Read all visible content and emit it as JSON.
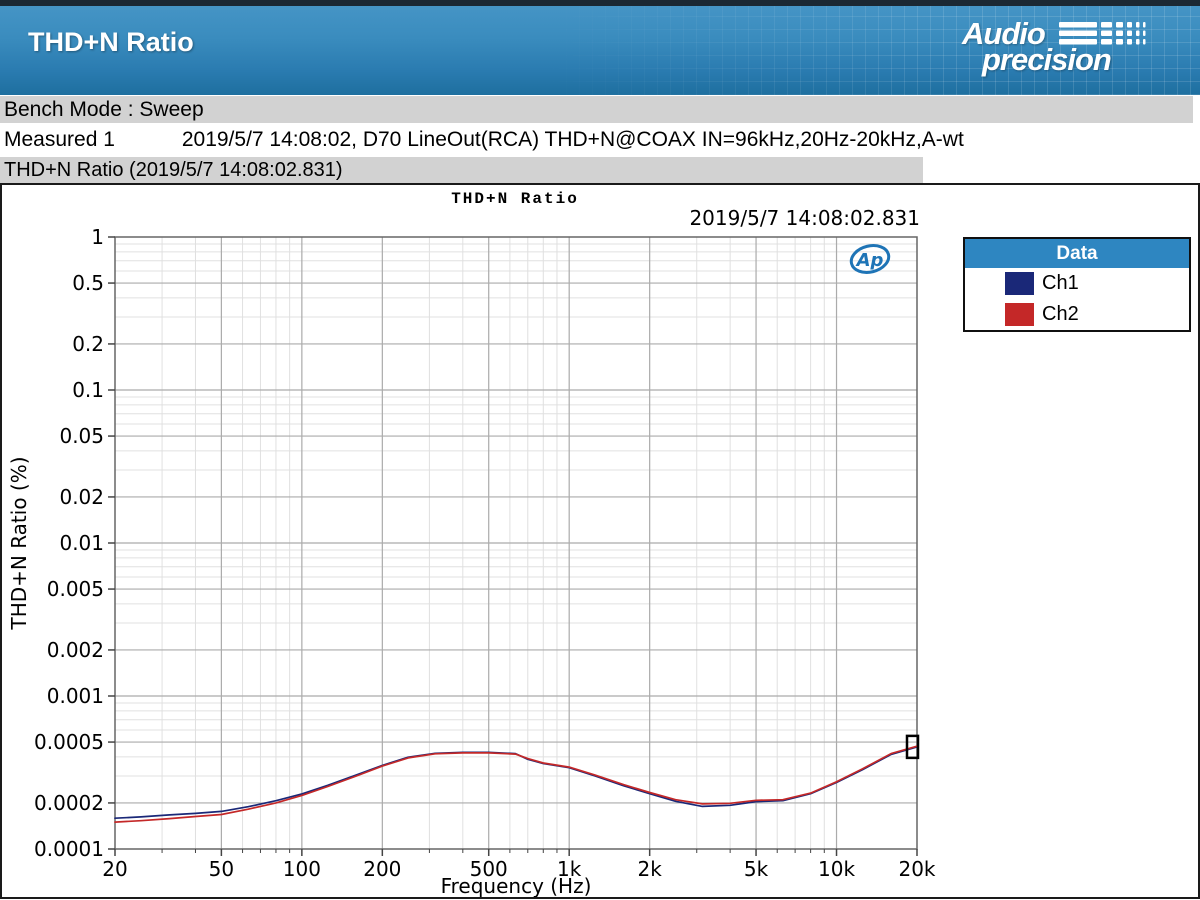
{
  "header": {
    "title": "THD+N Ratio",
    "logo_line1": "Audio",
    "logo_line2": "precision"
  },
  "bench_mode_label": "Bench Mode : Sweep",
  "measured": {
    "label": "Measured 1",
    "value": "2019/5/7 14:08:02, D70 LineOut(RCA) THD+N@COAX IN=96kHz,20Hz-20kHz,A-wt"
  },
  "section_title": "THD+N Ratio (2019/5/7 14:08:02.831)",
  "colors": {
    "header_blue_top": "#4796c7",
    "header_blue_bottom": "#1e6f9f",
    "bar_gray": "#d2d2d2",
    "legend_header_blue": "#2e86c1",
    "grid_major": "#ababab",
    "grid_minor": "#e0e0e0",
    "plot_border": "#666666",
    "tick_color": "#444444",
    "ap_logo_blue": "#1e74b6"
  },
  "chart_data": {
    "type": "line",
    "title": "THD+N Ratio",
    "timestamp": "2019/5/7 14:08:02.831",
    "xlabel": "Frequency (Hz)",
    "ylabel": "THD+N Ratio (%)",
    "x_scale": "log",
    "y_scale": "log",
    "xlim": [
      20,
      20000
    ],
    "ylim": [
      0.0001,
      1
    ],
    "grid": true,
    "x_major_ticks": [
      20,
      50,
      100,
      200,
      500,
      1000,
      2000,
      5000,
      10000,
      20000
    ],
    "x_tick_labels": [
      "20",
      "50",
      "100",
      "200",
      "500",
      "1k",
      "2k",
      "5k",
      "10k",
      "20k"
    ],
    "y_major_ticks": [
      1,
      0.5,
      0.2,
      0.1,
      0.05,
      0.02,
      0.01,
      0.005,
      0.002,
      0.001,
      0.0005,
      0.0002,
      0.0001
    ],
    "y_tick_labels": [
      "1",
      "0.5",
      "0.2",
      "0.1",
      "0.05",
      "0.02",
      "0.01",
      "0.005",
      "0.002",
      "0.001",
      "0.0005",
      "0.0002",
      "0.0001"
    ],
    "legend": {
      "title": "Data",
      "position": "outside-top-right"
    },
    "watermark": "Ap",
    "cursor_marker": {
      "x": 20000,
      "y": 0.000465
    },
    "series": [
      {
        "name": "Ch1",
        "color": "#1a2878",
        "x": [
          20,
          25,
          32,
          40,
          50,
          63,
          80,
          100,
          125,
          160,
          200,
          250,
          315,
          400,
          500,
          630,
          700,
          800,
          1000,
          1250,
          1600,
          2000,
          2500,
          3150,
          4000,
          5000,
          6300,
          8000,
          10000,
          12500,
          16000,
          20000
        ],
        "values": [
          0.000159,
          0.000162,
          0.000167,
          0.000171,
          0.000176,
          0.000189,
          0.000207,
          0.000229,
          0.000261,
          0.000305,
          0.000352,
          0.000398,
          0.000422,
          0.000428,
          0.000428,
          0.00042,
          0.000386,
          0.000362,
          0.00034,
          0.0003,
          0.000259,
          0.00023,
          0.000205,
          0.00019,
          0.000193,
          0.000204,
          0.000207,
          0.00023,
          0.000272,
          0.00033,
          0.000415,
          0.000465
        ]
      },
      {
        "name": "Ch2",
        "color": "#c42828",
        "x": [
          20,
          25,
          32,
          40,
          50,
          63,
          80,
          100,
          125,
          160,
          200,
          250,
          315,
          400,
          500,
          630,
          700,
          800,
          1000,
          1250,
          1600,
          2000,
          2500,
          3150,
          4000,
          5000,
          6300,
          8000,
          10000,
          12500,
          16000,
          20000
        ],
        "values": [
          0.00015,
          0.000153,
          0.000158,
          0.000163,
          0.000168,
          0.000182,
          0.0002,
          0.000224,
          0.000256,
          0.0003,
          0.000348,
          0.000394,
          0.000419,
          0.000425,
          0.000425,
          0.000417,
          0.00039,
          0.000365,
          0.000343,
          0.000304,
          0.000263,
          0.000234,
          0.00021,
          0.000197,
          0.000199,
          0.000208,
          0.00021,
          0.000232,
          0.000275,
          0.000334,
          0.00042,
          0.00047
        ]
      }
    ]
  }
}
